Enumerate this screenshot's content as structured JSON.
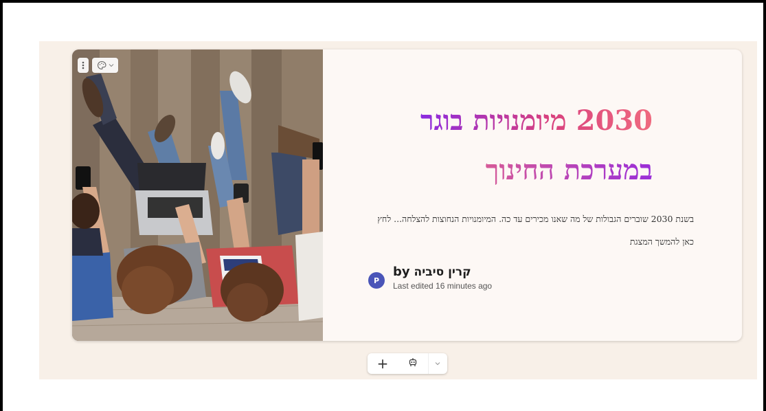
{
  "card": {
    "title_line1": "2030 מיומנויות בוגר",
    "title_line2": "במערכת החינוך",
    "description": "בשנת 2030 שוברים הגבולות של מה שאנו מכירים עד כה. המיומנויות הנחוצות להצלחה... לחץ כאן להמשך המצגת"
  },
  "author": {
    "avatar_letter": "P",
    "by_label": "by",
    "name": "קרין סיביה",
    "last_edited": "Last edited 16 minutes ago"
  },
  "image_toolbar": {
    "more_icon": "vertical-dots-icon",
    "style_icon": "palette-icon",
    "dropdown_icon": "chevron-down-icon"
  },
  "bottom_toolbar": {
    "add_icon": "plus-icon",
    "add_label": "+",
    "ai_icon": "robot-icon",
    "dropdown_icon": "chevron-down-icon"
  },
  "colors": {
    "canvas": "#f8f0e8",
    "card": "#fdf8f5",
    "title_gradient_start": "#ef6a7f",
    "title_gradient_end": "#8b2be0",
    "avatar": "#4a55b8"
  }
}
